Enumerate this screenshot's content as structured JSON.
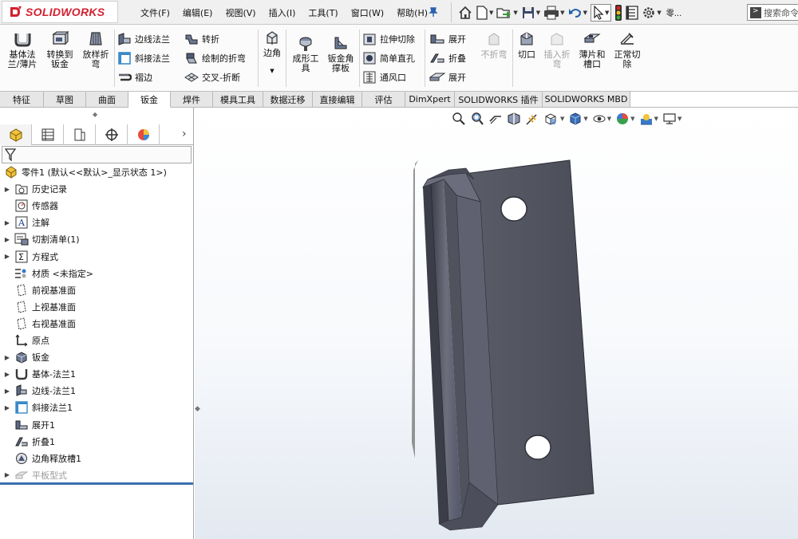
{
  "app": {
    "title": "SOLIDWORKS",
    "brand_color": "#d3202f"
  },
  "menu": [
    "文件(F)",
    "编辑(E)",
    "视图(V)",
    "插入(I)",
    "工具(T)",
    "窗口(W)",
    "帮助(H)"
  ],
  "quick_access": {
    "icons": [
      "home-icon",
      "new-document-icon",
      "open-icon",
      "save-icon",
      "print-icon",
      "undo-icon",
      "select-pointer-icon",
      "rebuild-icon",
      "file-properties-icon",
      "options-gear-icon"
    ],
    "overflow_label": "零..."
  },
  "search": {
    "placeholder": "搜索命令"
  },
  "ribbon": {
    "base_flange": "基体法\n兰/薄片",
    "convert_sheet": "转换到\n钣金",
    "lofted_bend": "放样折\n弯",
    "edge_flange": "边线法兰",
    "miter_flange": "斜接法兰",
    "hem": "褶边",
    "jog": "转折",
    "sketched_bend": "绘制的折弯",
    "cross_break": "交叉-折断",
    "corners": "边角",
    "forming_tool": "成形工\n具",
    "gusset": "钣金角\n撑板",
    "extruded_cut": "拉伸切除",
    "simple_hole": "简单直孔",
    "vent": "通风口",
    "unfold": "展开",
    "fold": "折叠",
    "flatten": "展开",
    "no_bends": "不折弯",
    "rip": "切口",
    "insert_bends": "插入折\n弯",
    "tab_slot": "薄片和\n槽口",
    "normal_cut": "正常切\n除"
  },
  "tabs": [
    "特征",
    "草图",
    "曲面",
    "钣金",
    "焊件",
    "模具工具",
    "数据迁移",
    "直接编辑",
    "评估",
    "DimXpert",
    "SOLIDWORKS 插件",
    "SOLIDWORKS MBD"
  ],
  "active_tab_index": 3,
  "feature_tree": {
    "root": "零件1 (默认<<默认>_显示状态 1>)",
    "items": [
      {
        "label": "历史记录",
        "icon": "history-folder-icon",
        "expandable": true
      },
      {
        "label": "传感器",
        "icon": "sensor-icon",
        "expandable": false
      },
      {
        "label": "注解",
        "icon": "annotation-icon",
        "expandable": true
      },
      {
        "label": "切割清单(1)",
        "icon": "cut-list-icon",
        "expandable": true
      },
      {
        "label": "方程式",
        "icon": "equation-icon",
        "expandable": true
      },
      {
        "label": "材质 <未指定>",
        "icon": "material-icon",
        "expandable": false
      },
      {
        "label": "前视基准面",
        "icon": "plane-icon",
        "expandable": false
      },
      {
        "label": "上视基准面",
        "icon": "plane-icon",
        "expandable": false
      },
      {
        "label": "右视基准面",
        "icon": "plane-icon",
        "expandable": false
      },
      {
        "label": "原点",
        "icon": "origin-icon",
        "expandable": false
      },
      {
        "label": "钣金",
        "icon": "sheet-metal-icon",
        "expandable": true
      },
      {
        "label": "基体-法兰1",
        "icon": "base-flange-icon",
        "expandable": true
      },
      {
        "label": "边线-法兰1",
        "icon": "edge-flange-icon",
        "expandable": true
      },
      {
        "label": "斜接法兰1",
        "icon": "miter-flange-icon",
        "expandable": true
      },
      {
        "label": "展开1",
        "icon": "unfold-icon",
        "expandable": false
      },
      {
        "label": "折叠1",
        "icon": "fold-icon",
        "expandable": false
      },
      {
        "label": "边角释放槽1",
        "icon": "corner-relief-icon",
        "expandable": false
      },
      {
        "label": "平板型式",
        "icon": "flat-pattern-icon",
        "expandable": true,
        "suppressed": true
      }
    ]
  },
  "view_toolbar": [
    "zoom-to-fit-icon",
    "zoom-area-icon",
    "previous-view-icon",
    "section-view-icon",
    "dynamic-annotation-icon",
    "view-orientation-icon",
    "display-style-icon",
    "hide-show-icon",
    "edit-appearance-icon",
    "scene-icon",
    "view-settings-icon"
  ]
}
